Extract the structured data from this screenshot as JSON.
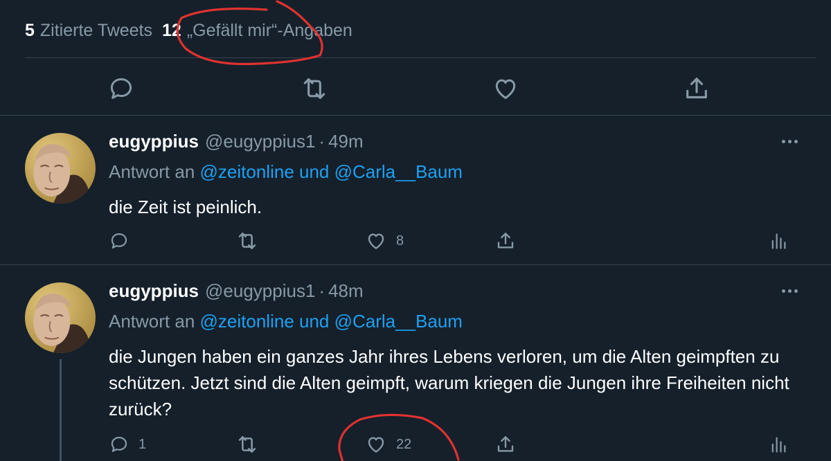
{
  "stats": {
    "quote_count": "5",
    "quote_label": "Zitierte Tweets",
    "likes_count": "12",
    "likes_label": "„Gefällt mir“-Angaben"
  },
  "main_actions": [
    "reply-icon",
    "retweet-icon",
    "like-icon",
    "share-icon"
  ],
  "replies": [
    {
      "display_name": "eugyppius",
      "handle": "@eugyppius1",
      "separator": "·",
      "time": "49m",
      "reply_prefix": "Antwort an",
      "reply_to_text": "@zeitonline und @Carla__Baum",
      "text": "die Zeit ist peinlich.",
      "reply_count": "",
      "like_count": "8"
    },
    {
      "display_name": "eugyppius",
      "handle": "@eugyppius1",
      "separator": "·",
      "time": "48m",
      "reply_prefix": "Antwort an",
      "reply_to_text": "@zeitonline und @Carla__Baum",
      "text": "die Jungen haben ein ganzes Jahr ihres Lebens verloren, um die Alten geimpften zu schützen. Jetzt sind die Alten geimpft, warum kriegen die Jungen ihre Freiheiten nicht zurück?",
      "reply_count": "1",
      "like_count": "22"
    }
  ],
  "colors": {
    "background": "#15202b",
    "divider": "#38444d",
    "secondary_text": "#8899a6",
    "link": "#1da1f2",
    "annotation": "#e0322f"
  }
}
